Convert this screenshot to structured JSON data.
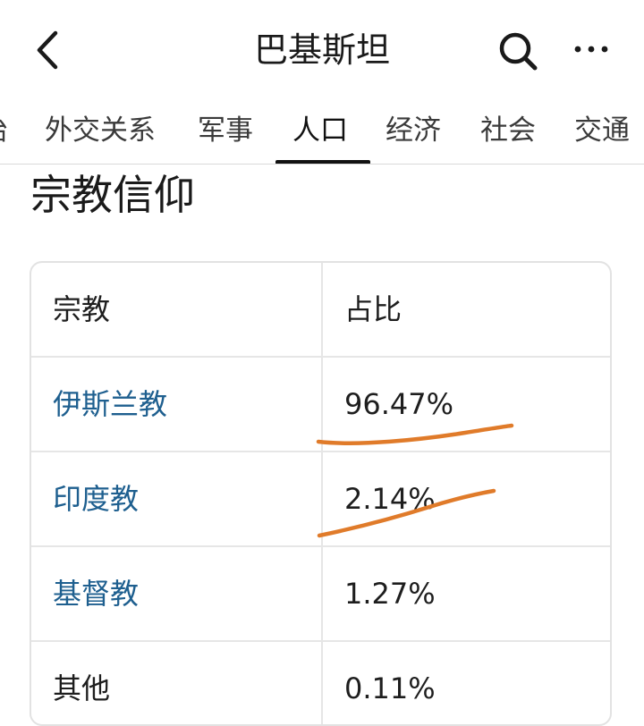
{
  "header": {
    "title": "巴基斯坦",
    "back_icon": "chevron-left-icon",
    "search_icon": "search-icon",
    "more_icon": "more-horizontal-icon"
  },
  "tabs": [
    {
      "label": "治"
    },
    {
      "label": "外交关系"
    },
    {
      "label": "军事"
    },
    {
      "label": "人口",
      "active": true
    },
    {
      "label": "经济"
    },
    {
      "label": "社会"
    },
    {
      "label": "交通"
    }
  ],
  "section": {
    "title": "宗教信仰"
  },
  "table": {
    "headers": [
      "宗教",
      "占比"
    ],
    "rows": [
      {
        "religion": "伊斯兰教",
        "share": "96.47%",
        "is_link": true,
        "underlined": true
      },
      {
        "religion": "印度教",
        "share": "2.14%",
        "is_link": true,
        "underlined": true
      },
      {
        "religion": "基督教",
        "share": "1.27%",
        "is_link": true,
        "underlined": false
      },
      {
        "religion": "其他",
        "share": "0.11%",
        "is_link": false,
        "underlined": false
      }
    ]
  },
  "colors": {
    "link": "#1e5f8f",
    "annotation": "#e07b2a",
    "text": "#1e1e1e",
    "border": "#e2e2e2"
  }
}
